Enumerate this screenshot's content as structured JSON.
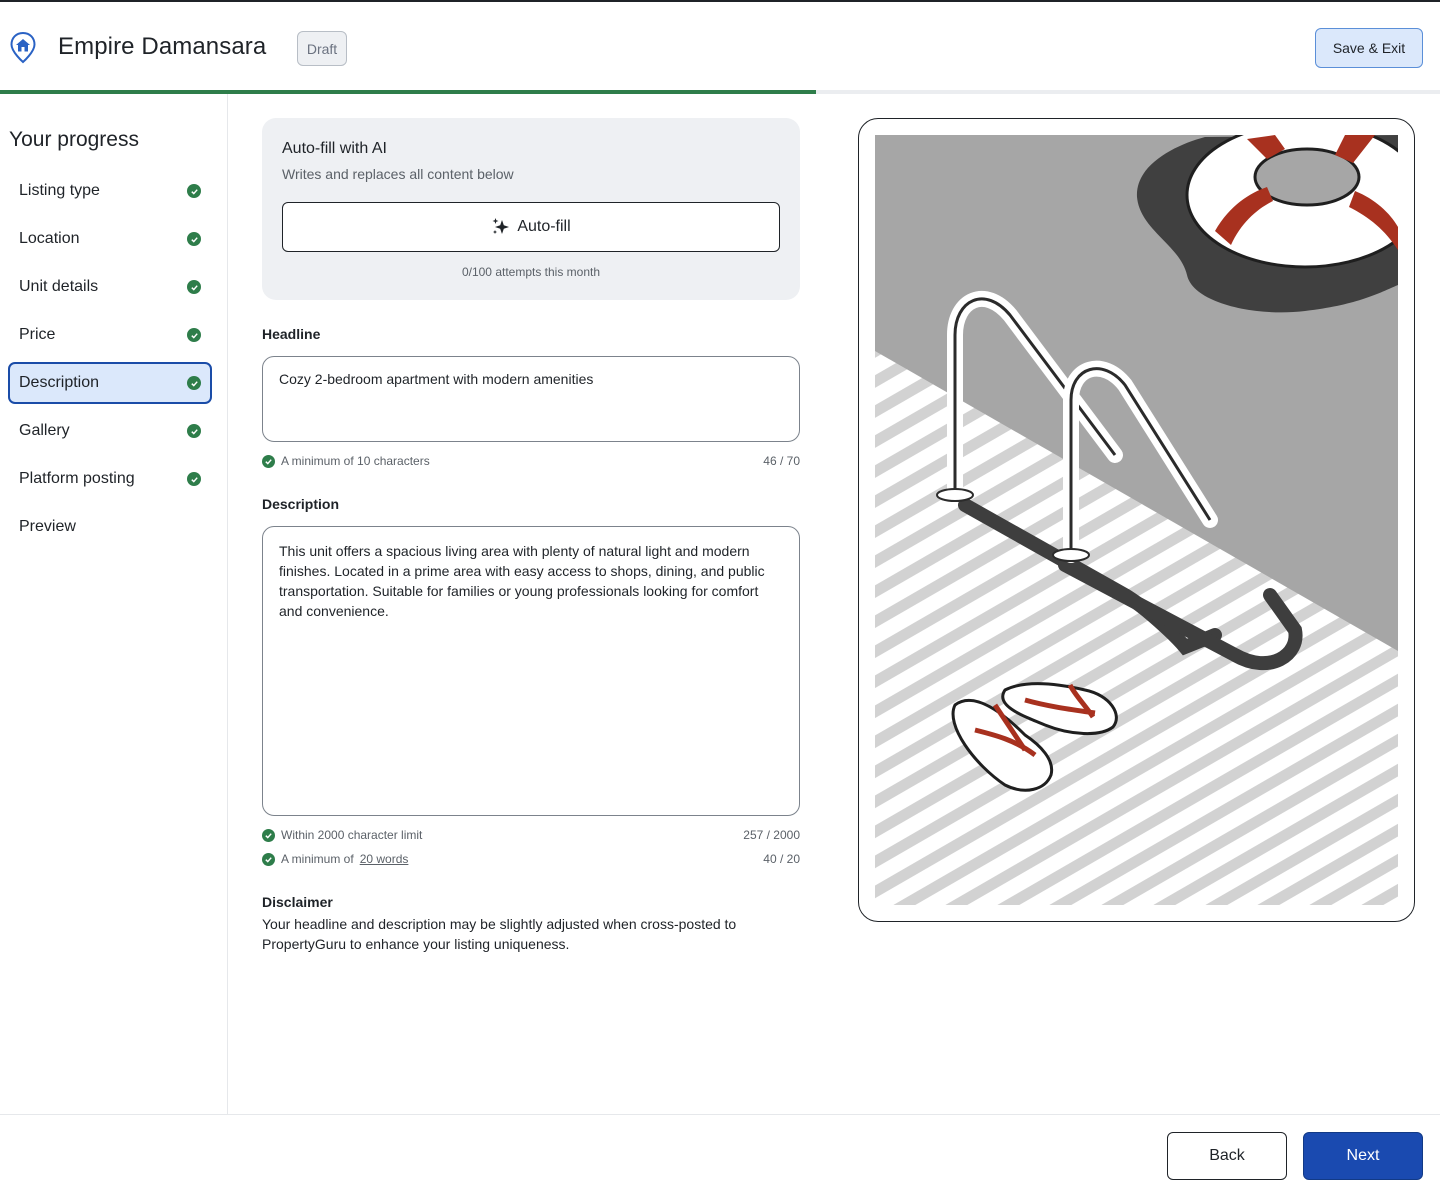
{
  "header": {
    "logo_icon": "house-pin-icon",
    "title": "Empire Damansara",
    "status_badge": "Draft",
    "save_exit_label": "Save & Exit"
  },
  "progress": {
    "completed_fraction": 0.567,
    "fill_color": "#2e7d4a"
  },
  "sidebar": {
    "heading": "Your progress",
    "steps": [
      {
        "label": "Listing type",
        "done": true,
        "active": false
      },
      {
        "label": "Location",
        "done": true,
        "active": false
      },
      {
        "label": "Unit details",
        "done": true,
        "active": false
      },
      {
        "label": "Price",
        "done": true,
        "active": false
      },
      {
        "label": "Description",
        "done": true,
        "active": true
      },
      {
        "label": "Gallery",
        "done": true,
        "active": false
      },
      {
        "label": "Platform posting",
        "done": true,
        "active": false
      },
      {
        "label": "Preview",
        "done": false,
        "active": false
      }
    ]
  },
  "ai": {
    "title": "Auto-fill with AI",
    "subtitle": "Writes and replaces all content below",
    "button_label": "Auto-fill",
    "button_icon": "sparkle-icon",
    "attempts": "0/100 attempts this month"
  },
  "headline": {
    "label": "Headline",
    "value": "Cozy 2-bedroom apartment with modern amenities",
    "hint": "A minimum of 10 characters",
    "count": "46 / 70"
  },
  "description": {
    "label": "Description",
    "value": "This unit offers a spacious living area with plenty of natural light and modern finishes. Located in a prime area with easy access to shops, dining, and public transportation. Suitable for families or young professionals looking for comfort and convenience.",
    "hint_limit": "Within 2000 character limit",
    "count_chars": "257 / 2000",
    "hint_words_prefix": "A minimum of",
    "hint_words_link": "20 words",
    "count_words": "40 / 20"
  },
  "disclaimer": {
    "title": "Disclaimer",
    "text": "Your headline and description may be slightly adjusted when cross-posted to PropertyGuru to enhance your listing uniqueness."
  },
  "footer": {
    "back_label": "Back",
    "next_label": "Next"
  },
  "colors": {
    "accent": "#1a4ab0",
    "success": "#2e7d4a",
    "active_bg": "#dbe8fb",
    "float_red": "#a8311f"
  }
}
